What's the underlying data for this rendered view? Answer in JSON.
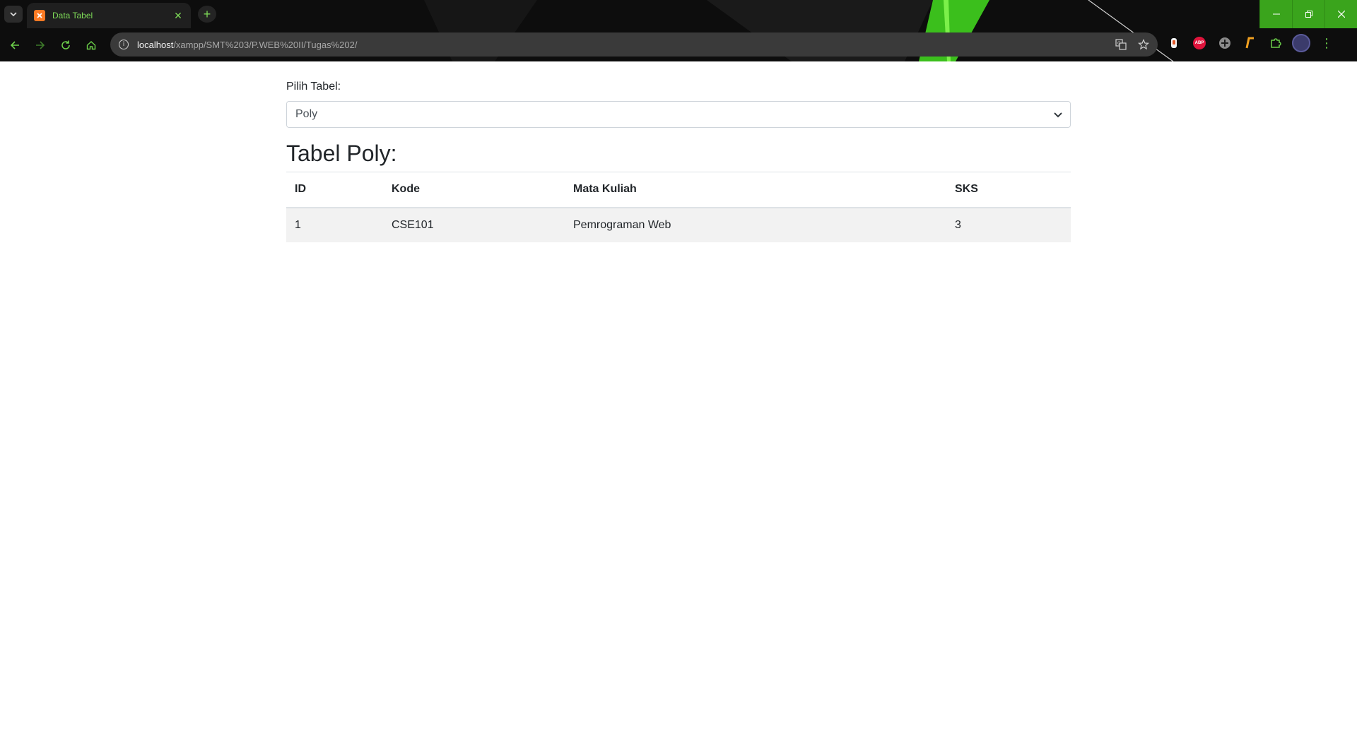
{
  "browser": {
    "tab_title": "Data Tabel",
    "url_host": "localhost",
    "url_path": "/xampp/SMT%203/P.WEB%20II/Tugas%202/",
    "accent_color": "#6ccf4a",
    "icons": {
      "back": "arrow-left-icon",
      "forward": "arrow-right-icon",
      "reload": "reload-icon",
      "home": "home-icon",
      "translate": "translate-icon",
      "bookmark": "star-icon",
      "extensions": "puzzle-icon",
      "menu": "three-dots-icon"
    }
  },
  "form": {
    "label": "Pilih Tabel:",
    "selected_option": "Poly"
  },
  "section": {
    "heading": "Tabel Poly:"
  },
  "table": {
    "headers": [
      "ID",
      "Kode",
      "Mata Kuliah",
      "SKS"
    ],
    "rows": [
      [
        "1",
        "CSE101",
        "Pemrograman Web",
        "3"
      ]
    ]
  }
}
